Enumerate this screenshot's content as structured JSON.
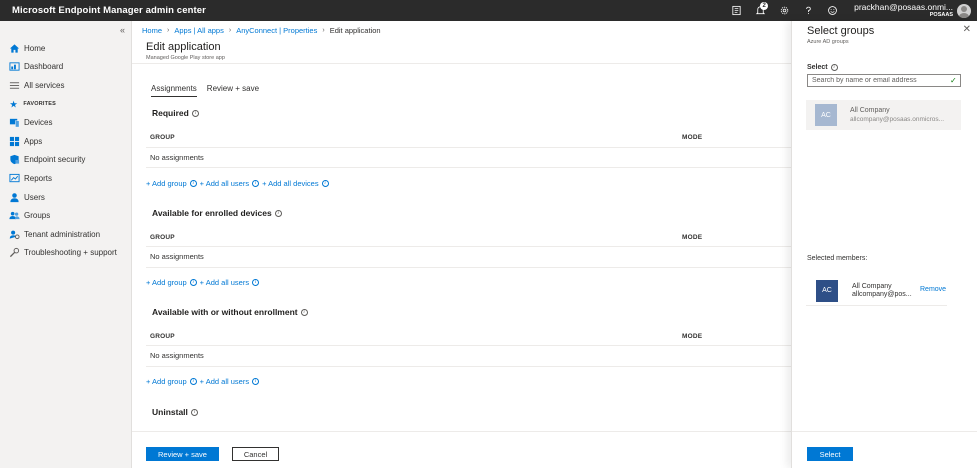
{
  "topbar": {
    "title": "Microsoft Endpoint Manager admin center",
    "notification_count": "2",
    "account_name": "prackhan@posaas.onmi...",
    "account_tenant": "POSAAS",
    "icons": [
      "device-share-icon",
      "notifications-icon",
      "settings-icon",
      "help-icon",
      "feedback-icon"
    ]
  },
  "sidebar": {
    "collapse": "«",
    "items": [
      {
        "label": "Home",
        "icon": "home-icon"
      },
      {
        "label": "Dashboard",
        "icon": "dashboard-icon"
      },
      {
        "label": "All services",
        "icon": "all-services-icon"
      }
    ],
    "favorites_label": "FAVORITES",
    "favorites": [
      {
        "label": "Devices",
        "icon": "devices-icon"
      },
      {
        "label": "Apps",
        "icon": "apps-icon"
      },
      {
        "label": "Endpoint security",
        "icon": "endpoint-security-icon"
      },
      {
        "label": "Reports",
        "icon": "reports-icon"
      },
      {
        "label": "Users",
        "icon": "users-icon"
      },
      {
        "label": "Groups",
        "icon": "groups-icon"
      },
      {
        "label": "Tenant administration",
        "icon": "tenant-admin-icon"
      },
      {
        "label": "Troubleshooting + support",
        "icon": "troubleshooting-icon"
      }
    ]
  },
  "breadcrumb": {
    "items": [
      "Home",
      "Apps | All apps",
      "AnyConnect | Properties"
    ],
    "current": "Edit application"
  },
  "page": {
    "title": "Edit application",
    "subtitle": "Managed Google Play store app"
  },
  "tabs": [
    "Assignments",
    "Review + save"
  ],
  "sections": {
    "required": {
      "title": "Required",
      "col_group": "GROUP",
      "col_mode": "MODE",
      "empty": "No assignments",
      "links": [
        "+ Add group",
        "+ Add all users",
        "+ Add all devices"
      ]
    },
    "enrolled": {
      "title": "Available for enrolled devices",
      "col_group": "GROUP",
      "col_mode": "MODE",
      "empty": "No assignments",
      "links": [
        "+ Add group",
        "+ Add all users"
      ]
    },
    "without": {
      "title": "Available with or without enrollment",
      "col_group": "GROUP",
      "col_mode": "MODE",
      "empty": "No assignments",
      "links": [
        "+ Add group",
        "+ Add all users"
      ]
    },
    "uninstall": {
      "title": "Uninstall"
    }
  },
  "footer": {
    "primary": "Review + save",
    "secondary": "Cancel"
  },
  "panel": {
    "title": "Select groups",
    "subtitle": "Azure AD groups",
    "close": "✕",
    "select_label": "Select",
    "search_placeholder": "Search by name or email address",
    "result": {
      "initials": "AC",
      "name": "All Company",
      "email": "allcompany@posaas.onmicros..."
    },
    "members_label": "Selected members:",
    "member": {
      "initials": "AC",
      "name": "All Company",
      "email": "allcompany@pos...",
      "remove": "Remove"
    },
    "select_button": "Select"
  },
  "colors": {
    "accent": "#0078d4",
    "topbar": "#2b2b2b",
    "member_avatar": "#2e4f87",
    "result_avatar": "#a6b8d1"
  }
}
